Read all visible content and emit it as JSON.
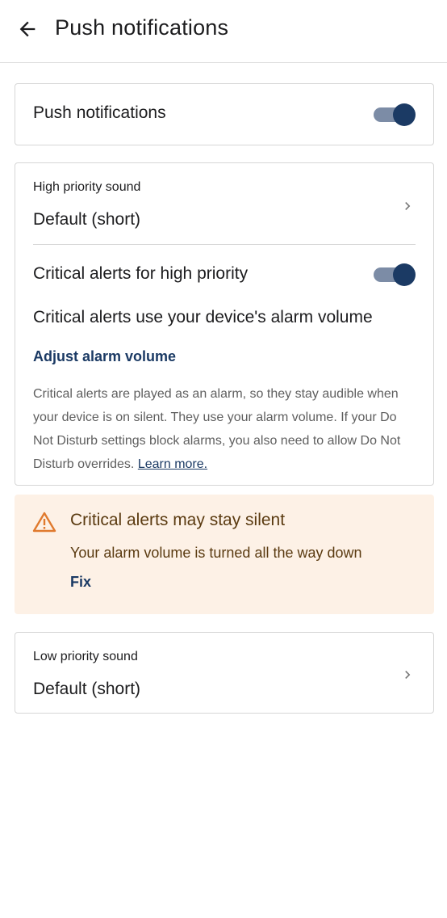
{
  "header": {
    "title": "Push notifications",
    "back_icon": "arrow-left-icon"
  },
  "push": {
    "label": "Push notifications",
    "enabled": true
  },
  "high_priority": {
    "sound_label": "High priority sound",
    "sound_value": "Default (short)",
    "critical_label": "Critical alerts for high priority",
    "critical_enabled": true,
    "alarm_heading": "Critical alerts use your device's alarm volume",
    "adjust_link": "Adjust alarm volume",
    "description": "Critical alerts are played as an alarm, so they stay audible when your device is on silent. They use your alarm volume. If your Do Not Disturb settings block alarms, you also need to allow Do Not Disturb overrides.",
    "learn_more": "Learn more."
  },
  "warning": {
    "title": "Critical alerts may stay silent",
    "body": "Your alarm volume is turned all the way down",
    "fix_label": "Fix",
    "icon": "warning-triangle-icon"
  },
  "low_priority": {
    "sound_label": "Low priority sound",
    "sound_value": "Default (short)"
  },
  "colors": {
    "accent": "#1b3a64",
    "toggle_track": "#7c8ca6",
    "warning_bg": "#fdf1e6",
    "warning_text": "#5a3a10",
    "warning_icon": "#e07a2e"
  }
}
